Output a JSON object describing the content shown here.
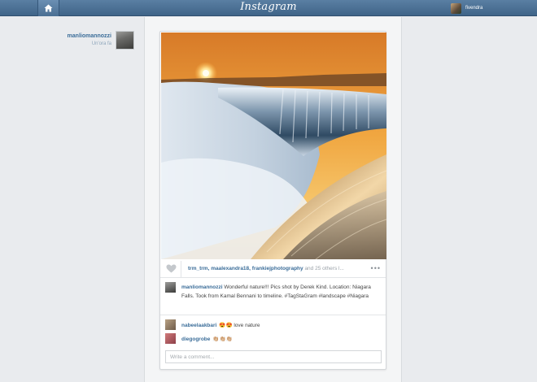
{
  "app": {
    "title": "Instagram"
  },
  "header": {
    "username": "fivendra"
  },
  "post": {
    "author": {
      "username": "manliomannozzi",
      "time": "Un'ora fa"
    },
    "likes": {
      "users": [
        "trm_trm",
        "maalexandra18",
        "frankiejphotography"
      ],
      "suffix": " and 25 others l..."
    },
    "more_label": "•••",
    "caption": {
      "username": "manliomannozzi",
      "text": " Wonderful nature!!! Pics shot by Derek Kind. Location: Niagara Falls. Took from Kamal Bennani to timeline. #TagStaGram #landscape #Niagara"
    },
    "comments": [
      {
        "username": "nabeelaakbari",
        "text": "😍😍 love nature"
      },
      {
        "username": "diegogrobe",
        "text": "👏🏼👏🏼👏🏼"
      }
    ],
    "comment_placeholder": "Write a comment..."
  }
}
